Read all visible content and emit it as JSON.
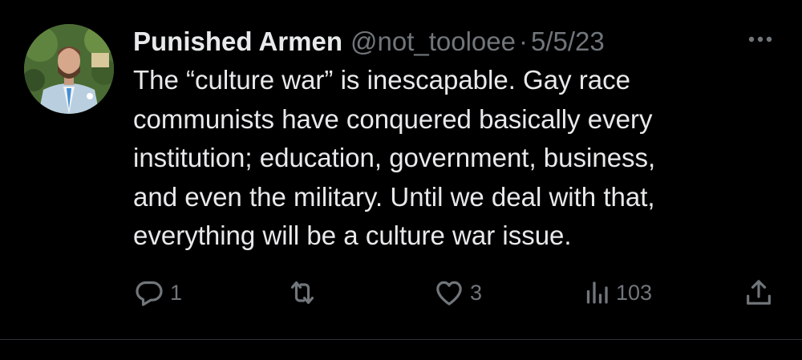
{
  "tweet": {
    "display_name": "Punished Armen",
    "handle": "@not_tooloee",
    "separator": "·",
    "date": "5/5/23",
    "text_lines": [
      "The “culture war” is inescapable. Gay race",
      "communists have conquered basically every",
      "institution; education, government, business,",
      "and even the military. Until we deal with that,",
      "everything will be a culture war issue."
    ]
  },
  "actions": {
    "reply_count": "1",
    "retweet_count": "",
    "like_count": "3",
    "views_count": "103"
  },
  "icons": {
    "more": "more-horizontal-icon",
    "reply": "reply-icon",
    "retweet": "retweet-icon",
    "like": "heart-icon",
    "views": "views-icon",
    "share": "share-icon"
  },
  "colors": {
    "background": "#000000",
    "primary_text": "#e7e9ea",
    "secondary_text": "#71767b",
    "divider": "#2f3336"
  }
}
